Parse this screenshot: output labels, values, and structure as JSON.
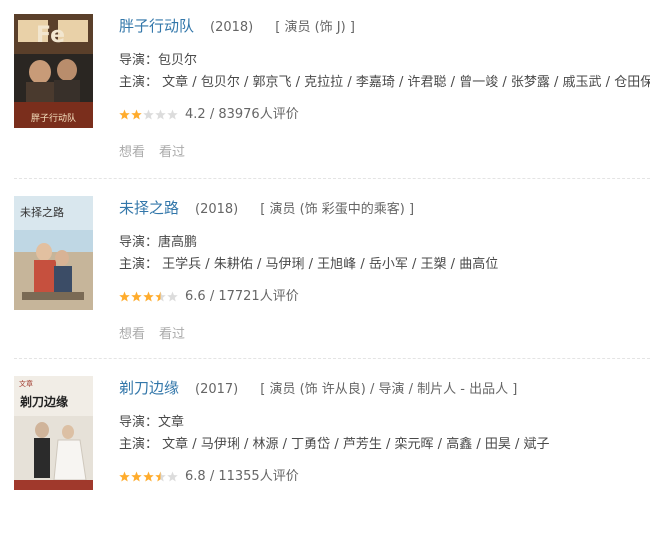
{
  "labels": {
    "director": "导演：",
    "cast": "主演：",
    "want": "想看",
    "seen": "看过"
  },
  "movies": [
    {
      "title": "胖子行动队",
      "year": "(2018)",
      "role": "[ 演员 (饰 J) ]",
      "director": "包贝尔",
      "cast": [
        "文章",
        "包贝尔",
        "郭京飞",
        "克拉拉",
        "李嘉琦",
        "许君聪",
        "曾一竣",
        "张梦露",
        "戚玉武",
        "仓田保"
      ],
      "score": "4.2",
      "votes": "83976人评价",
      "stars": 2,
      "poster_text": "胖子行动队"
    },
    {
      "title": "未择之路",
      "year": "(2018)",
      "role": "[ 演员 (饰 彩蛋中的乘客) ]",
      "director": "唐高鹏",
      "cast": [
        "王学兵",
        "朱耕佑",
        "马伊琍",
        "王旭峰",
        "岳小军",
        "王槊",
        "曲高位"
      ],
      "score": "6.6",
      "votes": "17721人评价",
      "stars": 3.5,
      "poster_text": "未择之路"
    },
    {
      "title": "剃刀边缘",
      "year": "(2017)",
      "role": "[ 演员 (饰 许从良) / 导演 / 制片人 - 出品人 ]",
      "director": "文章",
      "cast": [
        "文章",
        "马伊琍",
        "林源",
        "丁勇岱",
        "芦芳生",
        "栾元晖",
        "高鑫",
        "田昊",
        "斌子"
      ],
      "score": "6.8",
      "votes": "11355人评价",
      "stars": 3.5,
      "poster_text": "剃刀边缘"
    }
  ],
  "colors": {
    "link": "#3377aa",
    "star": "#ffac2d",
    "star_empty": "#dcdcdc"
  }
}
